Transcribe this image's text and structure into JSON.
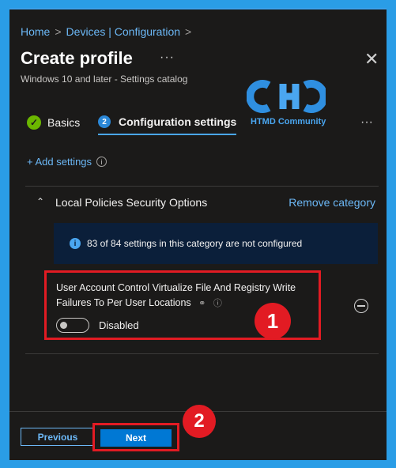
{
  "breadcrumb": {
    "home": "Home",
    "devices": "Devices | Configuration"
  },
  "header": {
    "title": "Create profile",
    "subtitle": "Windows 10 and later - Settings catalog",
    "more": "···",
    "close": "✕"
  },
  "logo": {
    "text": "HTMD Community"
  },
  "tabs": [
    {
      "label": "Basics",
      "icon": "✓"
    },
    {
      "label": "Configuration settings",
      "step": "2"
    }
  ],
  "tabs_more": "···",
  "add_settings": {
    "label": "+ Add settings",
    "info": "i"
  },
  "category": {
    "chevron": "⌃",
    "title": "Local Policies Security Options",
    "remove_label": "Remove category",
    "banner_icon": "i",
    "banner_text": "83 of 84 settings in this category are not configured"
  },
  "setting": {
    "label": "User Account Control Virtualize File And Registry Write Failures To Per User Locations",
    "toggle_state": "Disabled"
  },
  "footer": {
    "previous_label": "Previous",
    "next_label": "Next"
  },
  "annotations": {
    "first": "1",
    "second": "2"
  },
  "colors": {
    "accent": "#0078d4",
    "link": "#6cb8f6",
    "highlight": "#e21b23",
    "background": "#1b1a19"
  }
}
